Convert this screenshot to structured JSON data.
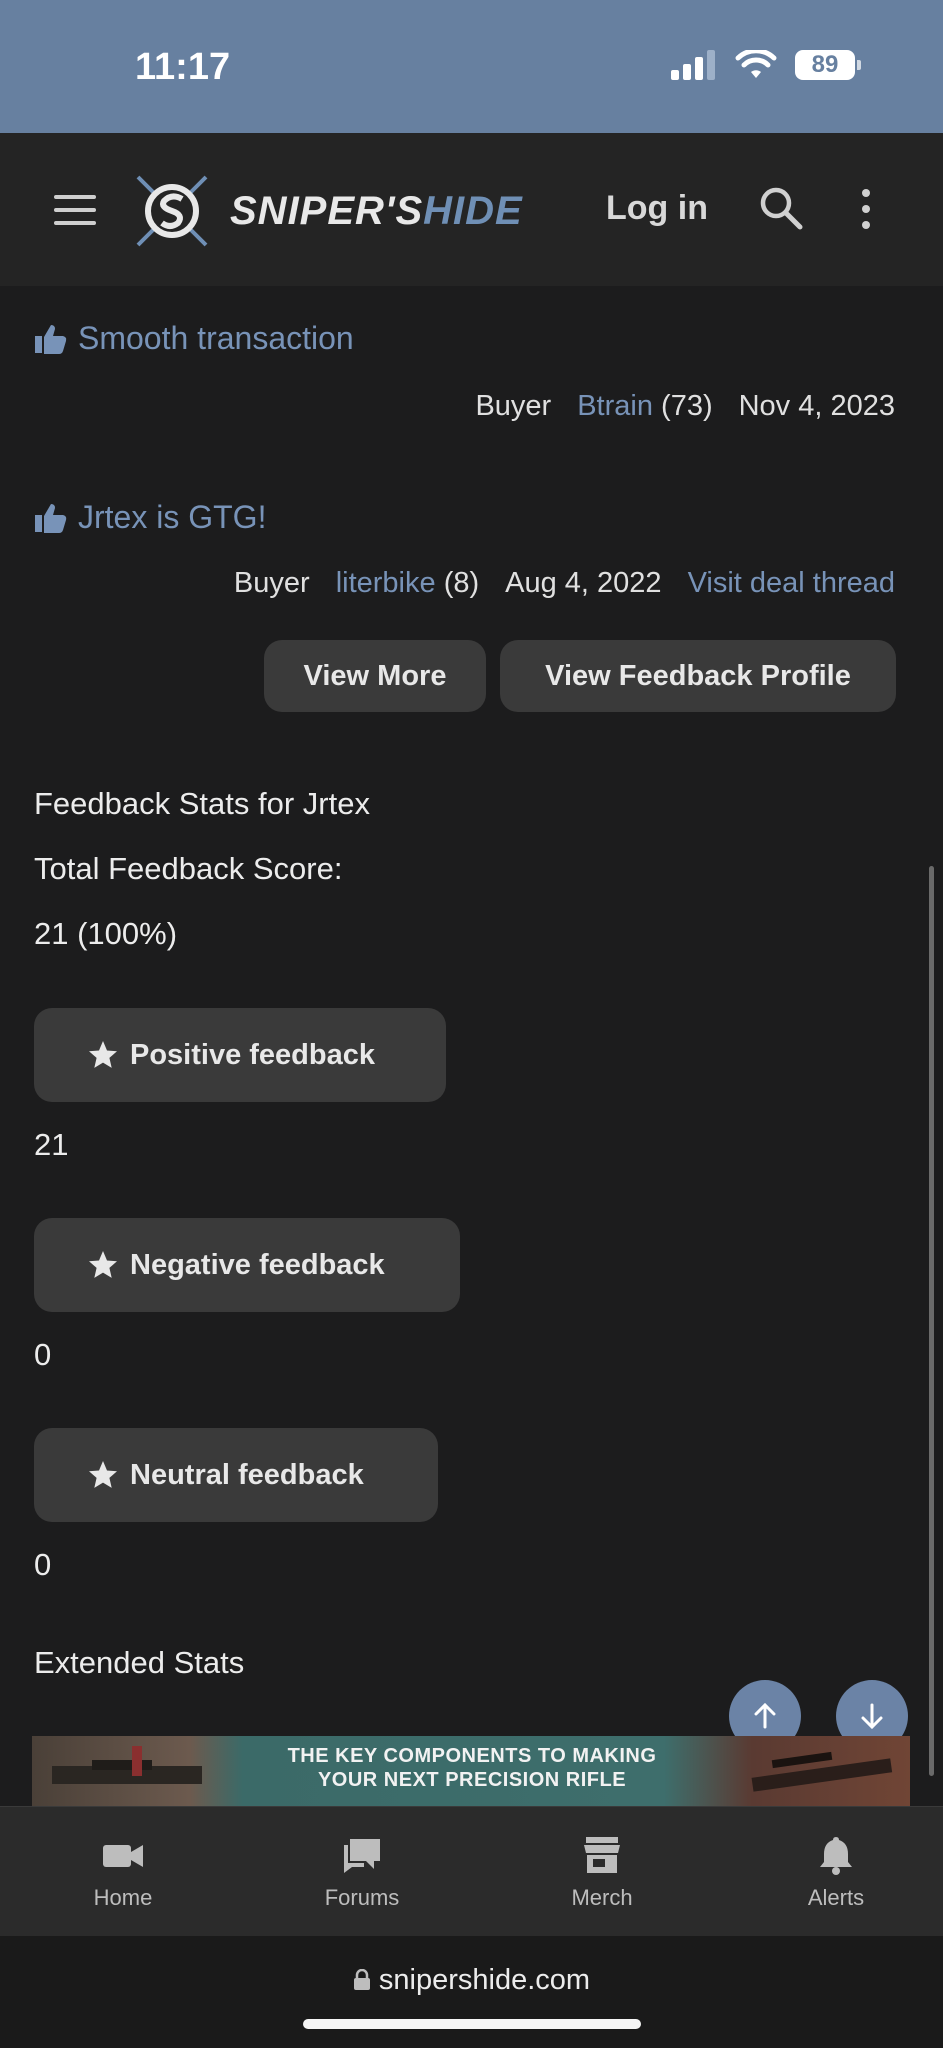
{
  "status_bar": {
    "time": "11:17",
    "battery": "89"
  },
  "header": {
    "logo_text_main": "SNIPER'S",
    "logo_text_accent": "HIDE",
    "login_label": "Log in"
  },
  "feedback_items": [
    {
      "title": "Smooth transaction",
      "role": "Buyer",
      "user": "Btrain",
      "count": "(73)",
      "date": "Nov 4, 2023"
    },
    {
      "title": "Jrtex is GTG!",
      "role": "Buyer",
      "user": "literbike",
      "count": "(8)",
      "date": "Aug 4, 2022",
      "link": "Visit deal thread"
    }
  ],
  "buttons": {
    "view_more": "View More",
    "view_profile": "View Feedback Profile"
  },
  "stats": {
    "heading": "Feedback Stats for Jrtex",
    "total_label": "Total Feedback Score:",
    "total_value": "21 (100%)",
    "positive_label": "Positive feedback",
    "positive_value": "21",
    "negative_label": "Negative feedback",
    "negative_value": "0",
    "neutral_label": "Neutral feedback",
    "neutral_value": "0",
    "extended_link": "Extended Stats"
  },
  "ad": {
    "line1": "THE KEY COMPONENTS TO MAKING",
    "line2": "YOUR NEXT PRECISION RIFLE"
  },
  "tabbar": {
    "home": "Home",
    "forums": "Forums",
    "merch": "Merch",
    "alerts": "Alerts"
  },
  "browser": {
    "url": "snipershide.com"
  },
  "colors": {
    "accent": "#7893b8",
    "header_bg": "#6780a0",
    "button_bg": "#3a3a3a"
  }
}
